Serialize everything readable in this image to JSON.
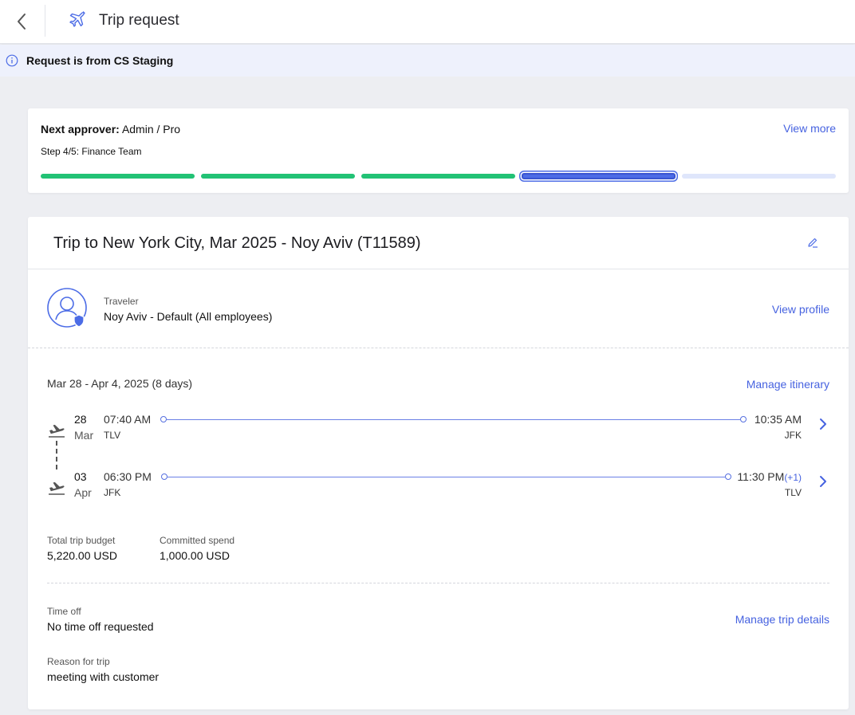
{
  "header": {
    "title": "Trip request",
    "back_icon": "chevron-left-icon",
    "trip_icon": "airplane-icon"
  },
  "banner": {
    "text": "Request is from CS Staging",
    "icon": "info-icon"
  },
  "approval": {
    "next_label": "Next approver:",
    "next_value": "Admin / Pro",
    "step": "Step 4/5: Finance Team",
    "view_more": "View more",
    "steps_total": 5,
    "steps_completed": 3,
    "current_step": 4,
    "colors": {
      "done": "#22c275",
      "current": "#4c6ce6",
      "todo": "#dfe6fb"
    }
  },
  "trip": {
    "title": "Trip to New York City, Mar 2025 - Noy Aviv (T11589)",
    "traveler_label": "Traveler",
    "traveler_name": "Noy Aviv - Default (All employees)",
    "view_profile": "View profile",
    "dates": "Mar 28 - Apr 4, 2025 (8 days)",
    "manage_itinerary": "Manage itinerary",
    "flights": [
      {
        "day": "28",
        "month": "Mar",
        "depart_time": "07:40 AM",
        "depart_code": "TLV",
        "arrive_time": "10:35 AM",
        "arrive_extra": "",
        "arrive_code": "JFK",
        "icon": "airplane-departure-icon"
      },
      {
        "day": "03",
        "month": "Apr",
        "depart_time": "06:30 PM",
        "depart_code": "JFK",
        "arrive_time": "11:30 PM",
        "arrive_extra": "(+1)",
        "arrive_code": "TLV",
        "icon": "airplane-departure-icon"
      }
    ],
    "budget": {
      "total_label": "Total trip budget",
      "total_value": "5,220.00 USD",
      "committed_label": "Committed spend",
      "committed_value": "1,000.00 USD"
    },
    "time_off_label": "Time off",
    "time_off_value": "No time off requested",
    "manage_trip_details": "Manage trip details",
    "reason_label": "Reason for trip",
    "reason_value": "meeting with customer"
  },
  "colors": {
    "accent": "#4662e0",
    "banner_bg": "#eef1fc",
    "page_bg": "#edeef2"
  }
}
